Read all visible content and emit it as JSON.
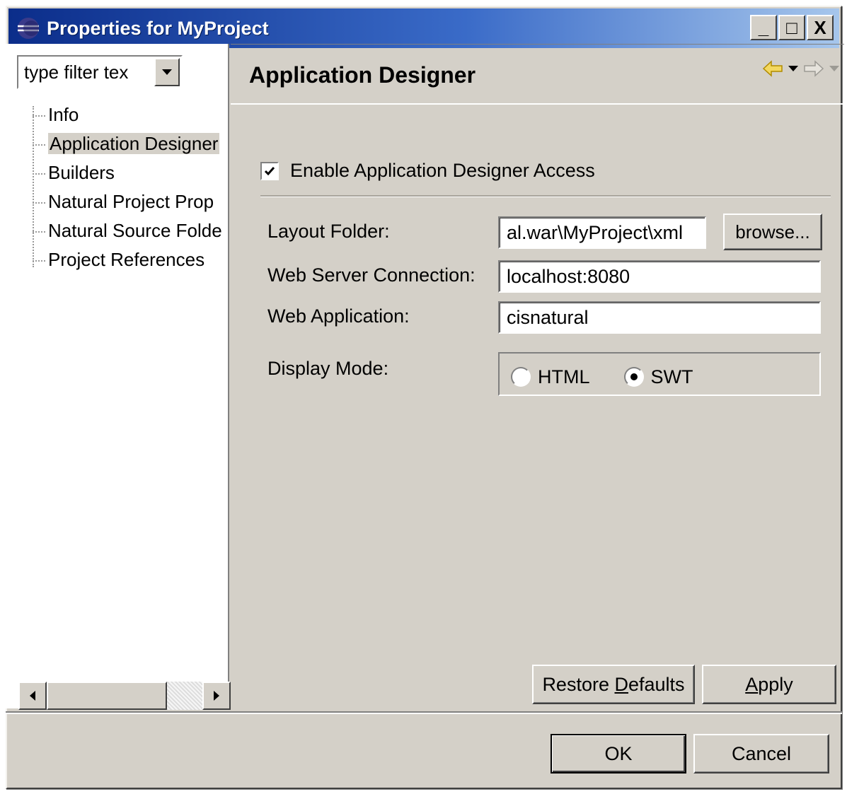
{
  "window": {
    "title": "Properties for MyProject",
    "minimize_label": "_",
    "maximize_label": "□",
    "close_label": "X"
  },
  "filter": {
    "value": "type filter tex"
  },
  "tree": {
    "items": [
      {
        "label": "Info"
      },
      {
        "label": "Application Designer",
        "selected": true
      },
      {
        "label": "Builders"
      },
      {
        "label": "Natural Project Prop"
      },
      {
        "label": "Natural Source Folde"
      },
      {
        "label": "Project References"
      }
    ]
  },
  "page": {
    "title": "Application Designer",
    "enable_access": {
      "label": "Enable Application Designer Access",
      "checked": true
    },
    "layout_folder": {
      "label": "Layout Folder:",
      "value": "al.war\\MyProject\\xml",
      "browse_label": "browse..."
    },
    "web_server": {
      "label": "Web Server Connection:",
      "value": "localhost:8080"
    },
    "web_application": {
      "label": "Web Application:",
      "value": "cisnatural"
    },
    "display_mode": {
      "label": "Display Mode:",
      "options": [
        {
          "label": "HTML",
          "selected": false
        },
        {
          "label": "SWT",
          "selected": true
        }
      ]
    },
    "restore_defaults": {
      "before": "Restore ",
      "mnemonic": "D",
      "after": "efaults"
    },
    "apply": {
      "before": "",
      "mnemonic": "A",
      "after": "pply"
    }
  },
  "dialog": {
    "ok_label": "OK",
    "cancel_label": "Cancel"
  },
  "colors": {
    "face": "#d4d0c8",
    "title_start": "#0b2d8a",
    "title_end": "#a6c6ec",
    "nav_arrow": "#e8b800"
  },
  "icons": {
    "title": "eclipse-icon",
    "back": "back-arrow-icon",
    "forward": "forward-arrow-icon"
  }
}
